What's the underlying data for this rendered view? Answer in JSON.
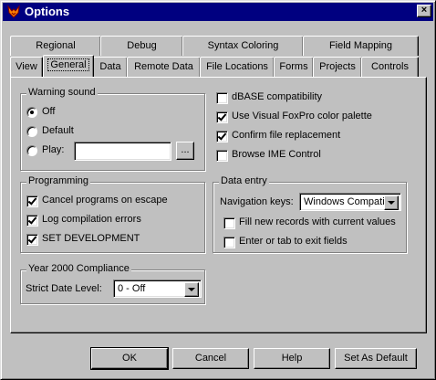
{
  "window": {
    "title": "Options",
    "close_label": "×"
  },
  "tabs_back": [
    "Regional",
    "Debug",
    "Syntax Coloring",
    "Field Mapping"
  ],
  "tabs_front": [
    "View",
    "General",
    "Data",
    "Remote Data",
    "File Locations",
    "Forms",
    "Projects",
    "Controls"
  ],
  "active_tab": "General",
  "warning_sound": {
    "title": "Warning sound",
    "off": "Off",
    "default": "Default",
    "play": "Play:",
    "play_path": "",
    "browse": "...",
    "selected": "Off"
  },
  "options": {
    "dbase": {
      "label": "dBASE compatibility",
      "checked": false
    },
    "vfp_palette": {
      "label": "Use Visual FoxPro color palette",
      "checked": true
    },
    "confirm_replace": {
      "label": "Confirm file replacement",
      "checked": true
    },
    "browse_ime": {
      "label": "Browse IME Control",
      "checked": false
    }
  },
  "programming": {
    "title": "Programming",
    "cancel_escape": {
      "label": "Cancel programs on escape",
      "checked": true
    },
    "log_errors": {
      "label": "Log compilation errors",
      "checked": true
    },
    "set_development": {
      "label": "SET DEVELOPMENT",
      "checked": true
    }
  },
  "data_entry": {
    "title": "Data entry",
    "nav_label": "Navigation keys:",
    "nav_value": "Windows Compatible",
    "fill_new": {
      "label": "Fill new records with current values",
      "checked": false
    },
    "enter_tab": {
      "label": "Enter or tab to exit fields",
      "checked": false
    }
  },
  "y2k": {
    "title": "Year 2000 Compliance",
    "strict_label": "Strict Date Level:",
    "strict_value": "0 - Off"
  },
  "buttons": {
    "ok": "OK",
    "cancel": "Cancel",
    "help": "Help",
    "set_default": "Set As Default"
  }
}
